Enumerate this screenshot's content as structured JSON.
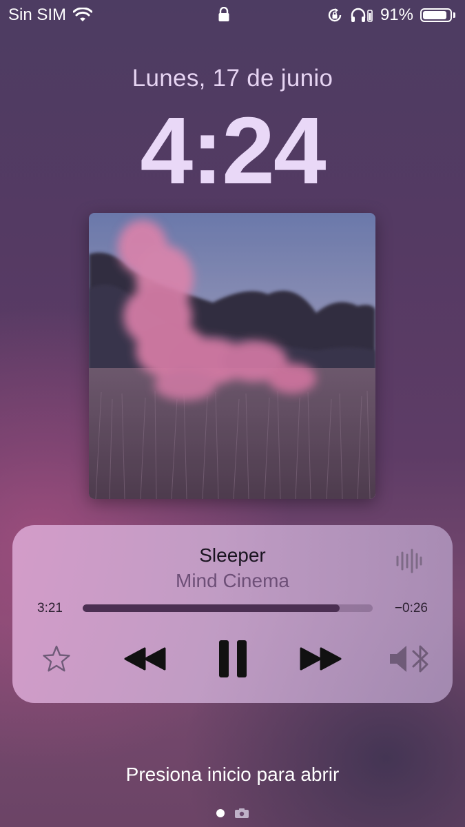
{
  "status_bar": {
    "carrier": "Sin SIM",
    "battery_text": "91%",
    "battery_level": 0.91,
    "icons": [
      "wifi-icon",
      "lock-icon",
      "rotation-lock-icon",
      "headphones-icon",
      "battery-icon"
    ]
  },
  "lockscreen": {
    "date": "Lunes, 17 de junio",
    "time": "4:24"
  },
  "now_playing": {
    "title": "Sleeper",
    "artist": "Mind Cinema",
    "elapsed": "3:21",
    "remaining": "−0:26",
    "progress": 0.885,
    "controls": [
      "star-icon",
      "rewind-icon",
      "pause-icon",
      "fast-forward-icon",
      "speaker-bluetooth-icon"
    ]
  },
  "footer": {
    "open_hint": "Presiona inicio para abrir"
  },
  "colors": {
    "accent_text": "#e9d8f7",
    "progress_fill": "#4b2f52"
  }
}
